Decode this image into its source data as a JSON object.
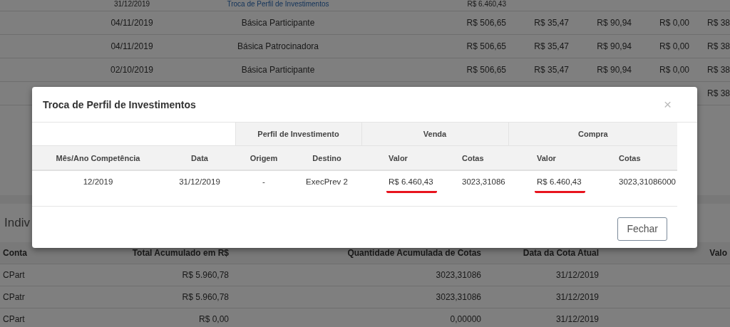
{
  "background": {
    "top_rows": [
      {
        "cells": [
          "31/12/2019",
          "Troca de Perfil de Investimentos",
          "R$ 6.460,43",
          "",
          "",
          "",
          ""
        ],
        "link": true
      },
      {
        "cells": [
          "04/11/2019",
          "Básica Participante",
          "R$ 506,65",
          "R$ 35,47",
          "R$ 90,94",
          "R$ 0,00",
          "R$ 38"
        ],
        "link": false
      },
      {
        "cells": [
          "04/11/2019",
          "Básica Patrocinadora",
          "R$ 506,65",
          "R$ 35,47",
          "R$ 90,94",
          "R$ 0,00",
          "R$ 38"
        ],
        "link": false
      },
      {
        "cells": [
          "02/10/2019",
          "Básica Participante",
          "R$ 506,65",
          "R$ 35,47",
          "R$ 90,94",
          "R$ 0,00",
          "R$ 38"
        ],
        "link": false
      },
      {
        "cells": [
          "",
          "",
          "",
          "",
          "",
          "",
          "R$ 38"
        ],
        "link": false
      }
    ],
    "section_title": "Indiv",
    "accounts_table": {
      "columns": [
        "Conta",
        "Total Acumulado em R$",
        "Quantidade Acumulada de Cotas",
        "Data da Cota Atual",
        "Valo"
      ],
      "rows": [
        [
          "CPart",
          "R$ 5.960,78",
          "3023,31086",
          "31/12/2019"
        ],
        [
          "CPatr",
          "R$ 5.960,78",
          "3023,31086",
          "31/12/2019"
        ],
        [
          "CPart",
          "R$ 0,00",
          "0,00000",
          "31/12/2019"
        ]
      ]
    }
  },
  "modal": {
    "title": "Troca de Perfil de Investimentos",
    "close": "×",
    "group_headers": [
      "Perfil de Investimento",
      "Venda",
      "Compra"
    ],
    "columns": [
      "Mês/Ano Competência",
      "Data",
      "Origem",
      "Destino",
      "Valor",
      "Cotas",
      "Valor",
      "Cotas"
    ],
    "rows": [
      {
        "cells": [
          {
            "text": "12/2019",
            "highlighted": false
          },
          {
            "text": "31/12/2019",
            "highlighted": false
          },
          {
            "text": "-",
            "highlighted": false
          },
          {
            "text": "ExecPrev 2",
            "highlighted": false
          },
          {
            "text": "R$ 6.460,43",
            "highlighted": true
          },
          {
            "text": "3023,31086",
            "highlighted": false
          },
          {
            "text": "R$ 6.460,43",
            "highlighted": true
          },
          {
            "text": "3023,31086000",
            "highlighted": false
          }
        ]
      }
    ],
    "button": "Fechar"
  }
}
